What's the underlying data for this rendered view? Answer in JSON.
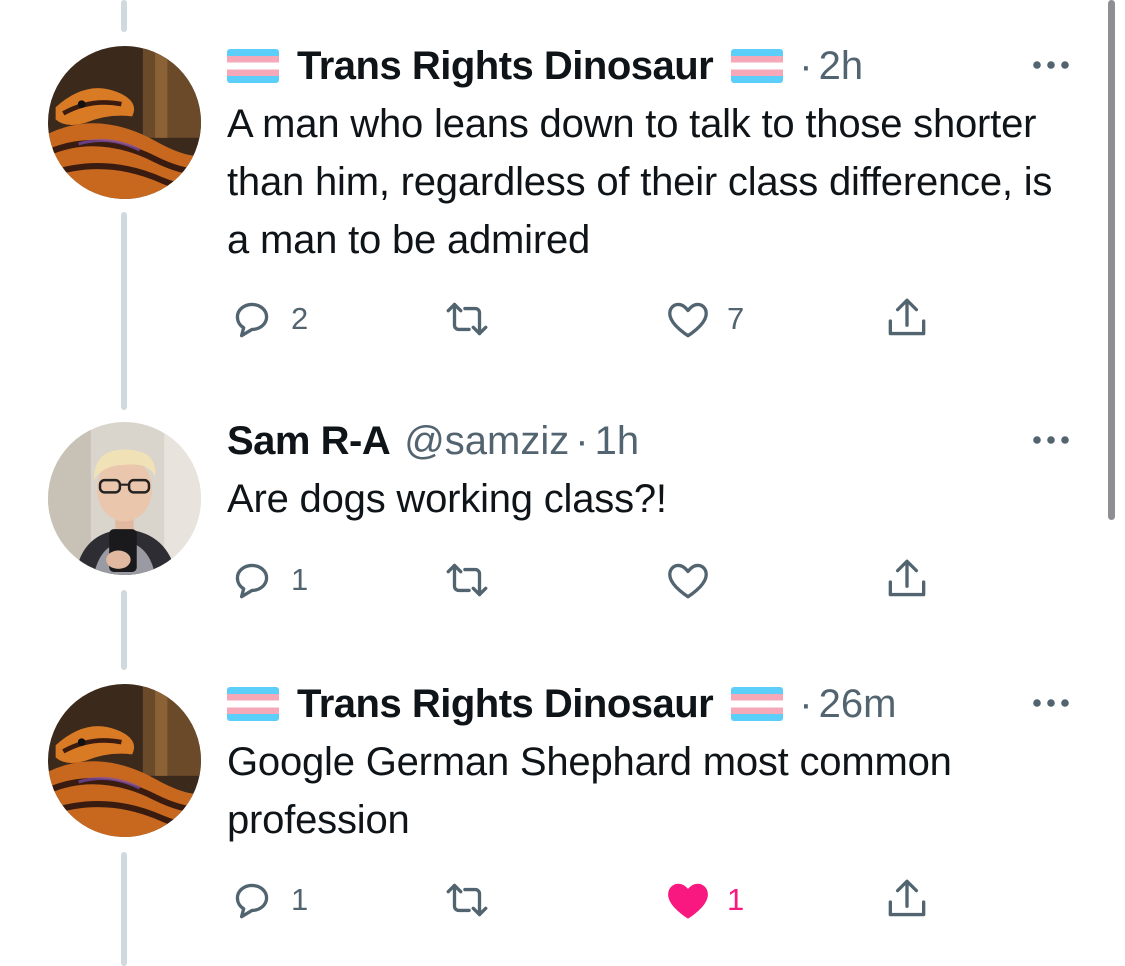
{
  "tweets": [
    {
      "name": "Trans Rights Dinosaur",
      "handle": "",
      "separator": "·",
      "time": "2h",
      "text": "A man who leans down to talk to those shorter than him, regardless of their class difference, is a man to be admired",
      "replies": "2",
      "retweets": "",
      "likes": "7",
      "liked": false,
      "avatar": "snake-avatar"
    },
    {
      "name": "Sam R-A",
      "handle": "@samziz",
      "separator": "·",
      "time": "1h",
      "text": "Are dogs working class?!",
      "replies": "1",
      "retweets": "",
      "likes": "",
      "liked": false,
      "avatar": "person-avatar"
    },
    {
      "name": "Trans Rights Dinosaur",
      "handle": "",
      "separator": "·",
      "time": "26m",
      "text": "Google German Shephard most common profession",
      "replies": "1",
      "retweets": "",
      "likes": "1",
      "liked": true,
      "avatar": "snake-avatar"
    }
  ],
  "colors": {
    "text": "#0f1419",
    "secondary": "#536471",
    "like_active": "#f91880",
    "thread_line": "#cfd9de",
    "flag_blue": "#5bcefa",
    "flag_pink": "#f5a9b8"
  },
  "icons": [
    "reply-icon",
    "retweet-icon",
    "like-icon",
    "share-icon",
    "more-icon",
    "trans-flag-emoji"
  ]
}
